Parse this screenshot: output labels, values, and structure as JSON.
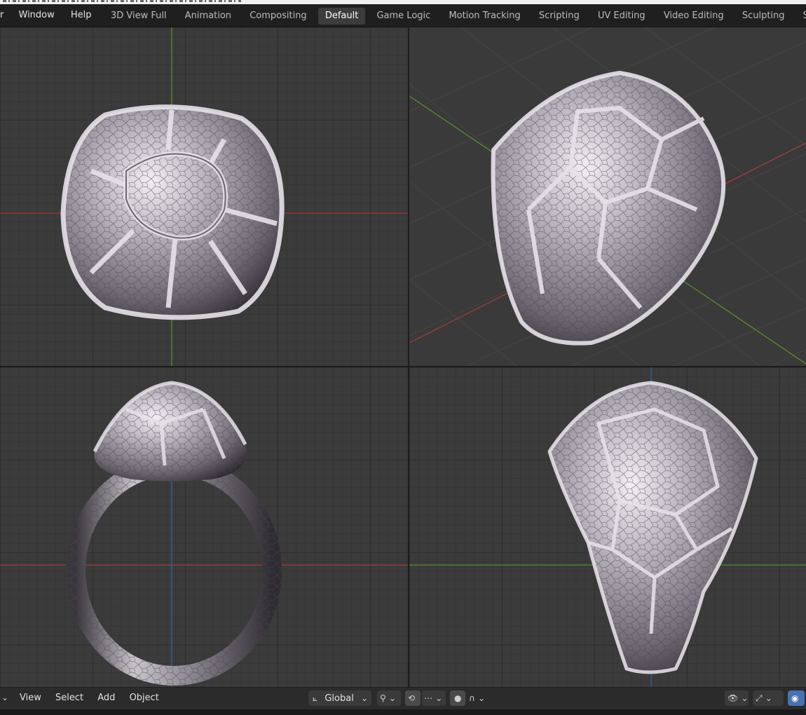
{
  "top_menu": {
    "partial_item": "r",
    "window": "Window",
    "help": "Help"
  },
  "workspace_tabs": [
    {
      "label": "3D View Full"
    },
    {
      "label": "Animation"
    },
    {
      "label": "Compositing"
    },
    {
      "label": "Default",
      "active": true
    },
    {
      "label": "Game Logic"
    },
    {
      "label": "Motion Tracking"
    },
    {
      "label": "Scripting"
    },
    {
      "label": "UV Editing"
    },
    {
      "label": "Video Editing"
    },
    {
      "label": "Sculpting"
    },
    {
      "label": "Shading"
    }
  ],
  "footer": {
    "menus": {
      "view": "View",
      "select": "Select",
      "add": "Add",
      "object": "Object"
    },
    "transform_orientation": "Global",
    "icons": [
      "transform-orientation-icon",
      "pivot-icon",
      "snap-icon",
      "snap-increment-icon",
      "proportional-edit-icon",
      "falloff-icon",
      "visibility-icon",
      "gizmo-icon",
      "overlay-icon"
    ]
  },
  "colors": {
    "x_axis": "#a23a3a",
    "y_axis": "#5a8a2e",
    "z_axis": "#3a5f9a",
    "active_tab": "#3c3c3c",
    "metal": "#b8b2bb"
  }
}
